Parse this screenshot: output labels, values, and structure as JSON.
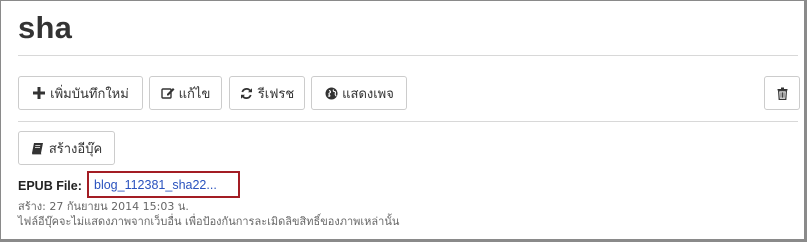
{
  "page": {
    "title": "sha"
  },
  "toolbar": {
    "add_label": "เพิ่มบันทึกใหม่",
    "edit_label": "แก้ไข",
    "refresh_label": "รีเฟรช",
    "show_label": "แสดงเพจ"
  },
  "ebook": {
    "create_label": "สร้างอีบุ๊ค"
  },
  "epub": {
    "label": "EPUB File:",
    "filename": "blog_112381_sha22...",
    "created": "สร้าง: 27 กันยายน 2014 15:03 น.",
    "note": "ไฟล์อีบุ๊คจะไม่แสดงภาพจากเว็บอื่น เพื่อป้องกันการละเมิดลิขสิทธิ์ของภาพเหล่านั้น"
  },
  "icons": {
    "add": "plus-icon",
    "edit": "edit-icon",
    "refresh": "refresh-icon",
    "show": "globe-icon",
    "delete": "trash-icon",
    "ebook": "book-icon"
  },
  "colors": {
    "link": "#2a52be",
    "highlight": "#a31d24",
    "border": "#cccccc"
  }
}
